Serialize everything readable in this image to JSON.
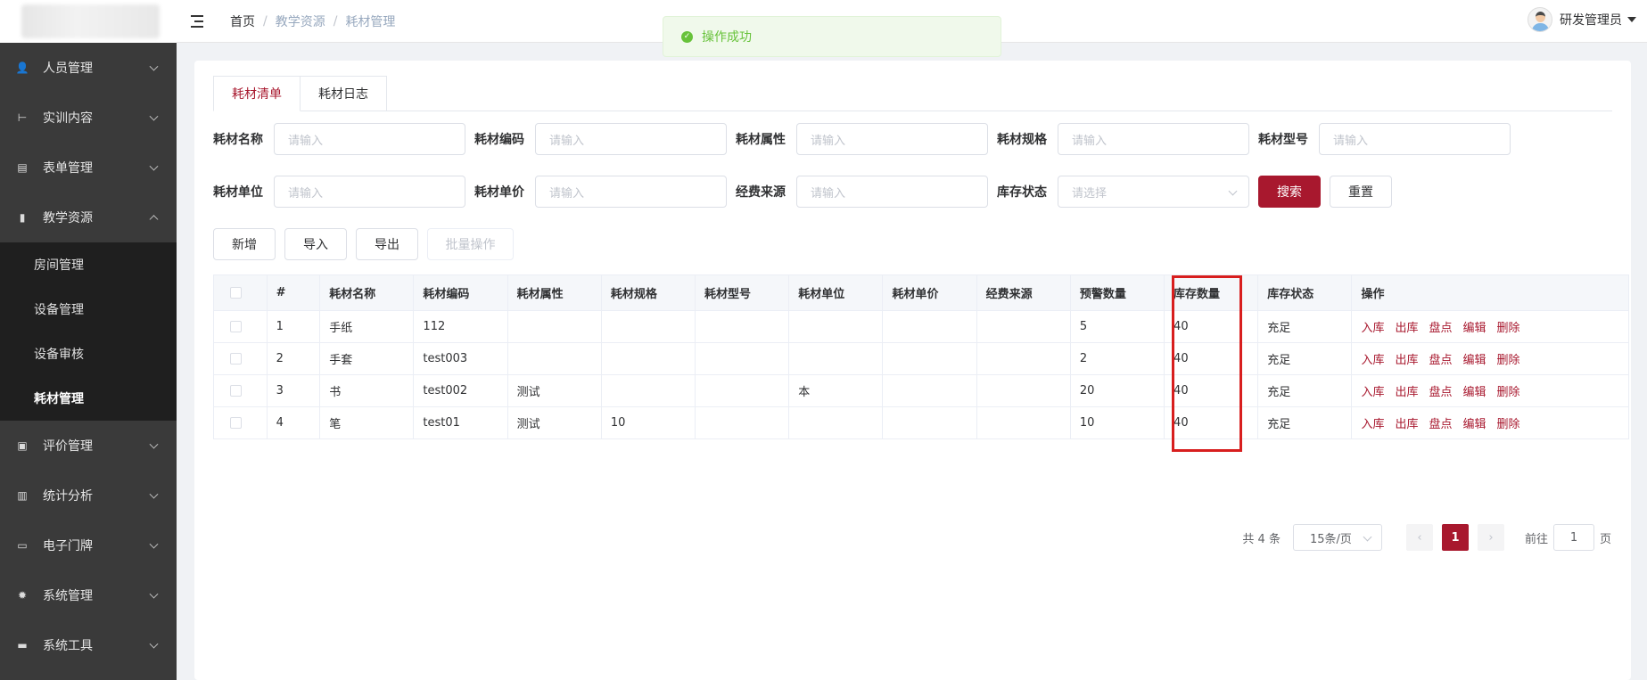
{
  "sidebar": {
    "items": [
      {
        "label": "人员管理",
        "icon": "user-icon"
      },
      {
        "label": "实训内容",
        "icon": "tree-icon"
      },
      {
        "label": "表单管理",
        "icon": "form-icon"
      },
      {
        "label": "教学资源",
        "icon": "book-icon",
        "expanded": true
      },
      {
        "label": "评价管理",
        "icon": "chart-box-icon"
      },
      {
        "label": "统计分析",
        "icon": "bar-chart-icon"
      },
      {
        "label": "电子门牌",
        "icon": "monitor-icon"
      },
      {
        "label": "系统管理",
        "icon": "gear-icon"
      },
      {
        "label": "系统工具",
        "icon": "toolbox-icon"
      }
    ],
    "submenu": [
      {
        "label": "房间管理"
      },
      {
        "label": "设备管理"
      },
      {
        "label": "设备审核"
      },
      {
        "label": "耗材管理",
        "active": true
      }
    ]
  },
  "header": {
    "breadcrumb": [
      "首页",
      "教学资源",
      "耗材管理"
    ],
    "user_name": "研发管理员"
  },
  "toast": {
    "text": "操作成功",
    "type": "success"
  },
  "tabs": [
    {
      "label": "耗材清单",
      "active": true
    },
    {
      "label": "耗材日志",
      "active": false
    }
  ],
  "filters": {
    "row1": [
      {
        "label": "耗材名称",
        "placeholder": "请输入"
      },
      {
        "label": "耗材编码",
        "placeholder": "请输入"
      },
      {
        "label": "耗材属性",
        "placeholder": "请输入"
      },
      {
        "label": "耗材规格",
        "placeholder": "请输入"
      },
      {
        "label": "耗材型号",
        "placeholder": "请输入"
      }
    ],
    "row2": [
      {
        "label": "耗材单位",
        "placeholder": "请输入"
      },
      {
        "label": "耗材单价",
        "placeholder": "请输入"
      },
      {
        "label": "经费来源",
        "placeholder": "请输入"
      },
      {
        "label": "库存状态",
        "placeholder": "请选择"
      }
    ],
    "search_label": "搜索",
    "reset_label": "重置"
  },
  "toolbar": {
    "add_label": "新增",
    "import_label": "导入",
    "export_label": "导出",
    "batch_label": "批量操作"
  },
  "table": {
    "columns": [
      "#",
      "耗材名称",
      "耗材编码",
      "耗材属性",
      "耗材规格",
      "耗材型号",
      "耗材单位",
      "耗材单价",
      "经费来源",
      "预警数量",
      "库存数量",
      "库存状态",
      "操作"
    ],
    "rows": [
      {
        "no": "1",
        "name": "手纸",
        "code": "112",
        "attr": "",
        "spec": "",
        "model": "",
        "unit": "",
        "price": "",
        "fund": "",
        "warn": "5",
        "stock": "40",
        "status": "充足"
      },
      {
        "no": "2",
        "name": "手套",
        "code": "test003",
        "attr": "",
        "spec": "",
        "model": "",
        "unit": "",
        "price": "",
        "fund": "",
        "warn": "2",
        "stock": "40",
        "status": "充足"
      },
      {
        "no": "3",
        "name": "书",
        "code": "test002",
        "attr": "测试",
        "spec": "",
        "model": "",
        "unit": "本",
        "price": "",
        "fund": "",
        "warn": "20",
        "stock": "40",
        "status": "充足"
      },
      {
        "no": "4",
        "name": "笔",
        "code": "test01",
        "attr": "测试",
        "spec": "10",
        "model": "",
        "unit": "",
        "price": "",
        "fund": "",
        "warn": "10",
        "stock": "40",
        "status": "充足"
      }
    ],
    "actions": [
      "入库",
      "出库",
      "盘点",
      "编辑",
      "删除"
    ]
  },
  "pagination": {
    "total_text": "共 4 条",
    "page_size": "15条/页",
    "current_page": "1",
    "goto_prefix": "前往",
    "goto_value": "1",
    "goto_suffix": "页"
  }
}
